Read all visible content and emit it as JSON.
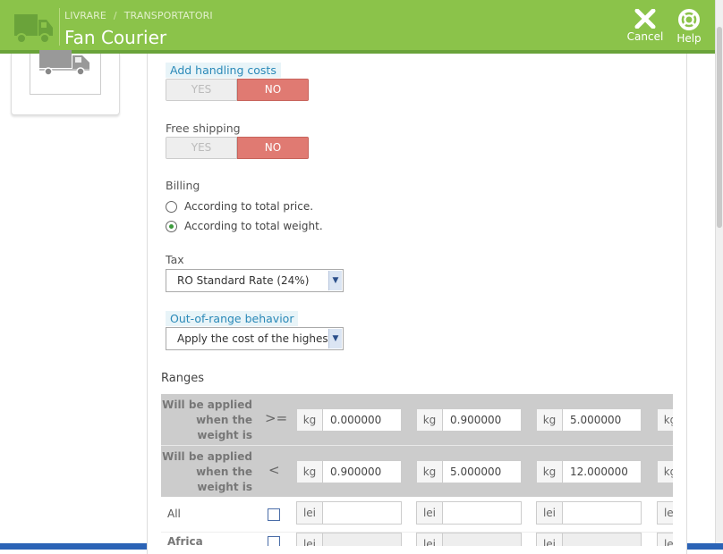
{
  "header": {
    "breadcrumb": [
      "LIVRARE",
      "TRANSPORTATORI"
    ],
    "breadcrumb_sep": "/",
    "title": "Fan Courier",
    "cancel_label": "Cancel",
    "help_label": "Help",
    "cancel_icon": "close-icon",
    "help_icon": "lifebuoy-icon"
  },
  "colors": {
    "header": "#8bc34a",
    "no_active": "#e07a72",
    "hint_bg": "#e8f4f8"
  },
  "form": {
    "handling": {
      "label": "Add handling costs",
      "yes": "YES",
      "no": "NO",
      "value": "NO"
    },
    "free_shipping": {
      "label": "Free shipping",
      "yes": "YES",
      "no": "NO",
      "value": "NO"
    },
    "billing": {
      "label": "Billing",
      "options": [
        "According to total price.",
        "According to total weight."
      ],
      "selected": "According to total weight."
    },
    "tax": {
      "label": "Tax",
      "value": "RO Standard Rate (24%)"
    },
    "out_of_range": {
      "label": "Out-of-range behavior",
      "value": "Apply the cost of the highest"
    }
  },
  "ranges": {
    "title": "Ranges",
    "row_label": [
      "Will be applied",
      "when the",
      "weight is"
    ],
    "gte_sign": ">=",
    "lt_sign": "<",
    "weight_unit": "kg",
    "price_unit": "lei",
    "from": [
      "0.000000",
      "0.900000",
      "5.000000"
    ],
    "to": [
      "0.900000",
      "5.000000",
      "12.000000"
    ],
    "zones": [
      "All",
      "Africa"
    ]
  }
}
